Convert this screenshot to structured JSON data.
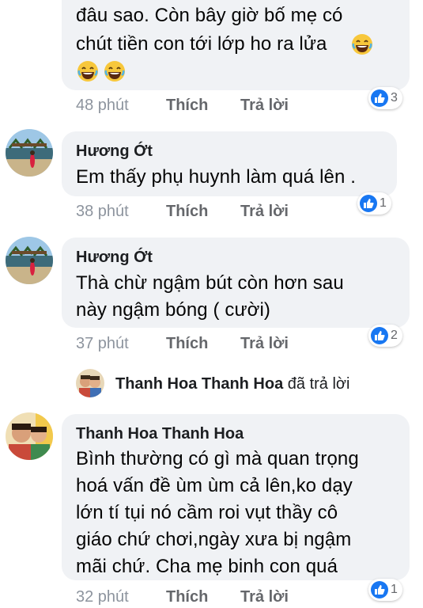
{
  "comments": [
    {
      "author": "",
      "lines": [
        "đâu sao. Còn bây giờ bố mẹ có",
        "chút tiền con tới lớp ho ra lửa"
      ],
      "time": "48 phút",
      "like_label": "Thích",
      "reply_label": "Trả lời",
      "reaction_count": "3"
    },
    {
      "author": "Hương Ớt",
      "lines": [
        "Em thấy phụ huynh làm quá lên ."
      ],
      "time": "38 phút",
      "like_label": "Thích",
      "reply_label": "Trả lời",
      "reaction_count": "1"
    },
    {
      "author": "Hương Ớt",
      "lines": [
        "Thà chừ ngậm bút còn hơn sau",
        "này ngậm bóng ( cười)"
      ],
      "time": "37 phút",
      "like_label": "Thích",
      "reply_label": "Trả lời",
      "reaction_count": "2"
    },
    {
      "author": "Thanh Hoa Thanh Hoa",
      "lines": [
        "Bình thường có gì mà quan trọng",
        "hoá vấn đề ùm ùm cả lên,ko dạy",
        "lớn tí tụi nó cầm roi vụt thầy cô",
        "giáo chứ chơi,ngày xưa bị ngậm",
        "mãi chứ. Cha mẹ binh con quá"
      ],
      "time": "32 phút",
      "like_label": "Thích",
      "reply_label": "Trả lời",
      "reaction_count": "1"
    }
  ],
  "reply_notice": {
    "name": "Thanh Hoa Thanh Hoa",
    "suffix": "đã trả lời"
  },
  "colors": {
    "bubble": "#f0f2f5",
    "like_blue": "#1877f2",
    "meta_gray": "#65676b"
  },
  "icons": [
    "laughing-emoji-icon",
    "thumbs-up-icon",
    "avatar"
  ]
}
